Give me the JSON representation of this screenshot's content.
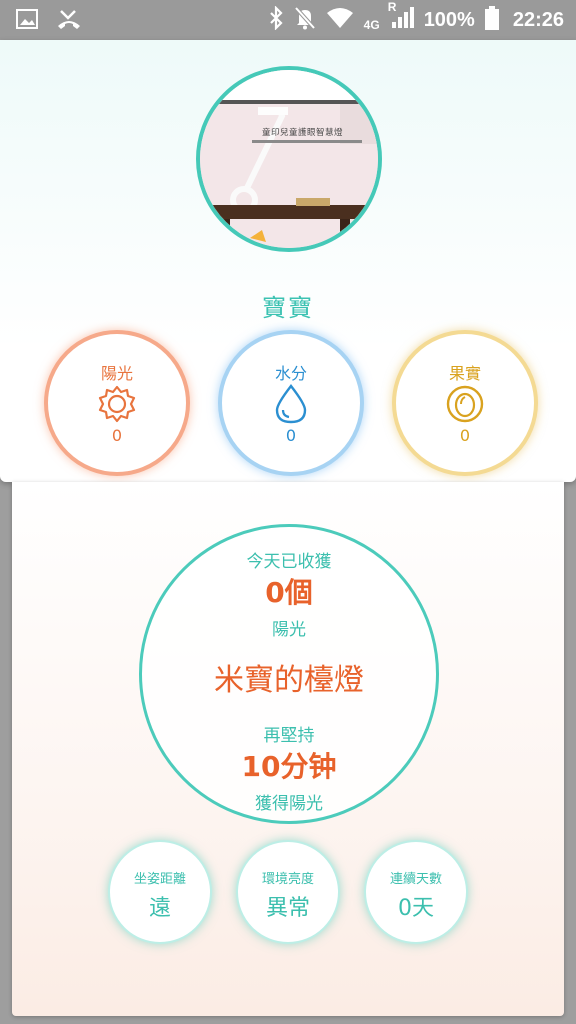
{
  "status_bar": {
    "network_type": "4G",
    "roaming_indicator": "R",
    "battery_percent": "100%",
    "time": "22:26",
    "icons": [
      "image-icon",
      "missed-call-icon",
      "bluetooth-icon",
      "notifications-off-icon",
      "wifi-icon",
      "signal-icon",
      "battery-icon"
    ]
  },
  "profile": {
    "name": "寶寶",
    "photo_caption": "童印兒童護眼智慧燈"
  },
  "stats": [
    {
      "label": "陽光",
      "value": "0",
      "icon": "sun-icon",
      "color": "#e8743e"
    },
    {
      "label": "水分",
      "value": "0",
      "icon": "water-drop-icon",
      "color": "#2b8fd1"
    },
    {
      "label": "果實",
      "value": "0",
      "icon": "fruit-icon",
      "color": "#d9a21f"
    }
  ],
  "harvest": {
    "today_label": "今天已收獲",
    "count": "0個",
    "unit_label": "陽光",
    "lamp_name": "米寶的檯燈",
    "keep_label": "再堅持",
    "remaining_time": "10分钟",
    "reward_label": "獲得陽光"
  },
  "metrics": [
    {
      "label": "坐姿距離",
      "value": "遠"
    },
    {
      "label": "環境亮度",
      "value": "異常"
    },
    {
      "label": "連續天數",
      "value": "0天"
    }
  ],
  "colors": {
    "accent_teal": "#3cbfae",
    "highlight_orange": "#e8622b"
  }
}
